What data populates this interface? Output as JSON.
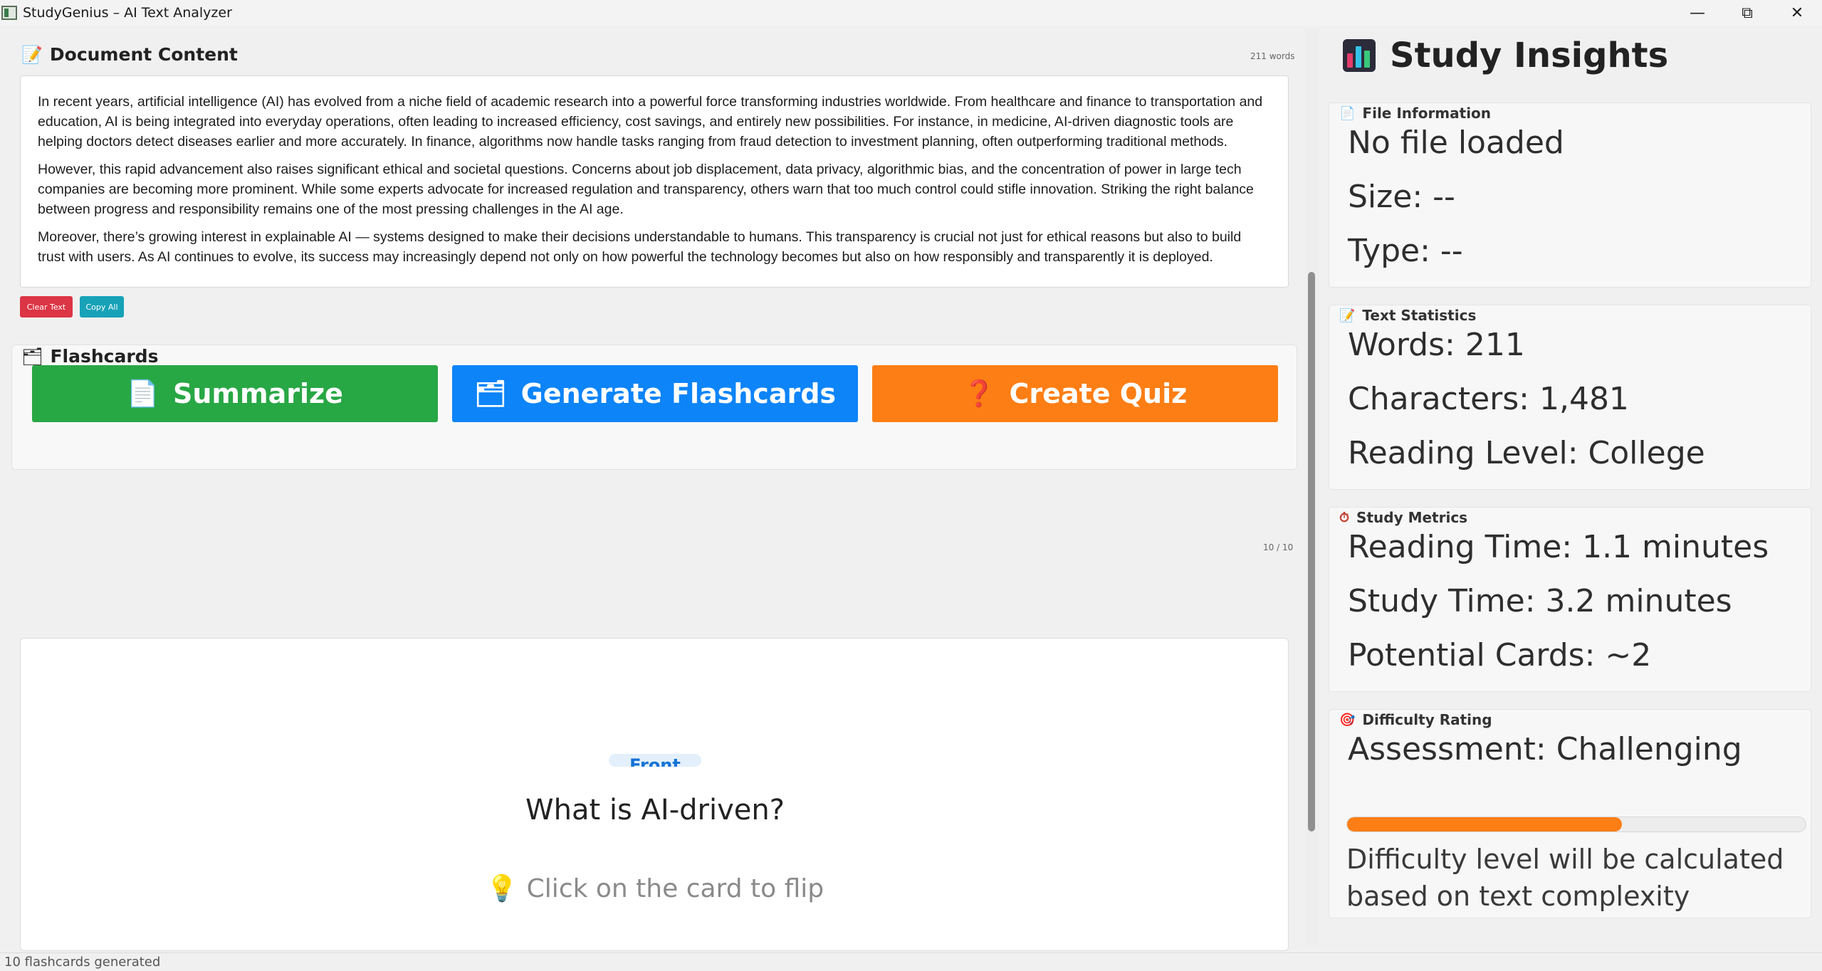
{
  "window": {
    "title": "StudyGenius – AI Text Analyzer",
    "minimize_icon": "minimize-icon",
    "maximize_icon": "restore-icon",
    "close_icon": "close-icon"
  },
  "document": {
    "title": "Document Content",
    "word_count": "211 words",
    "paragraphs": [
      "In recent years, artificial intelligence (AI) has evolved from a niche field of academic research into a powerful force transforming industries worldwide. From healthcare and finance to transportation and education, AI is being integrated into everyday operations, often leading to increased efficiency, cost savings, and entirely new possibilities. For instance, in medicine, AI-driven diagnostic tools are helping doctors detect diseases earlier and more accurately. In finance, algorithms now handle tasks ranging from fraud detection to investment planning, often outperforming traditional methods.",
      "However, this rapid advancement also raises significant ethical and societal questions. Concerns about job displacement, data privacy, algorithmic bias, and the concentration of power in large tech companies are becoming more prominent. While some experts advocate for increased regulation and transparency, others warn that too much control could stifle innovation. Striking the right balance between progress and responsibility remains one of the most pressing challenges in the AI age.",
      "Moreover, there’s growing interest in explainable AI — systems designed to make their decisions understandable to humans. This transparency is crucial not just for ethical reasons but also to build trust with users. As AI continues to evolve, its success may increasingly depend not only on how powerful the technology becomes but also on how responsibly and transparently it is deployed."
    ],
    "clear_label": "Clear Text",
    "copy_label": "Copy All",
    "clear_color": "#dc3545",
    "copy_color": "#17a2b8"
  },
  "actions": {
    "summarize_label": "Summarize",
    "flashcards_label": "Generate Flashcards",
    "quiz_label": "Create Quiz",
    "summarize_color": "#28a745",
    "flashcards_color": "#0d84f8",
    "quiz_color": "#fd7e14"
  },
  "flashcards": {
    "title": "Flashcards",
    "counter": "10 / 10",
    "card": {
      "side_tag": "Front",
      "question": "What is AI-driven?",
      "hint": "Click on the card to flip"
    }
  },
  "insights": {
    "title": "Study Insights",
    "file_info": {
      "heading": "File Information",
      "lines": [
        "No file loaded",
        "Size: --",
        "Type: --"
      ]
    },
    "text_stats": {
      "heading": "Text Statistics",
      "lines": [
        "Words: 211",
        "Characters: 1,481",
        "Reading Level: College"
      ]
    },
    "study_metrics": {
      "heading": "Study Metrics",
      "lines": [
        "Reading Time: 1.1 minutes",
        "Study Time: 3.2 minutes",
        "Potential Cards: ~2"
      ]
    },
    "difficulty": {
      "heading": "Difficulty Rating",
      "assessment": "Assessment: Challenging",
      "progress": 0.6,
      "description": "Difficulty level will be calculated based on text complexity"
    }
  },
  "status": {
    "text": "10 flashcards generated"
  }
}
